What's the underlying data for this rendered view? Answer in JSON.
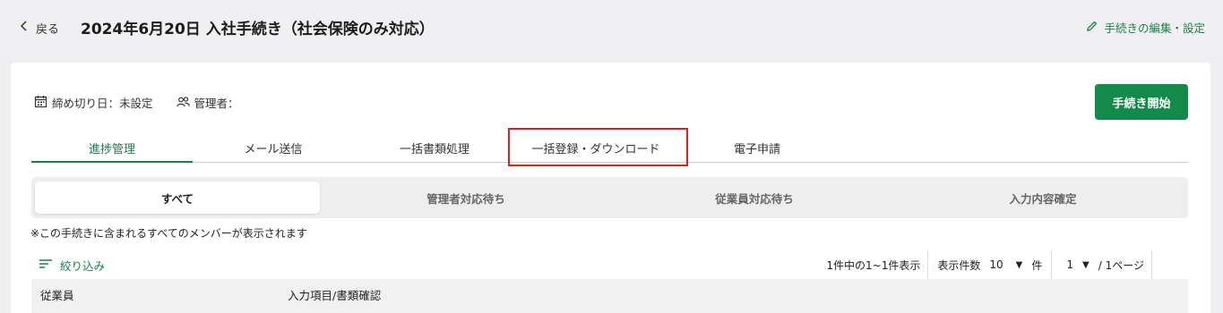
{
  "header": {
    "back_label": "戻る",
    "title": "2024年6月20日 入社手続き（社会保険のみ対応）",
    "edit_label": "手続きの編集・設定"
  },
  "meta": {
    "deadline": "締め切り日：未設定",
    "manager": "管理者："
  },
  "start_button": "手続き開始",
  "tabs": [
    {
      "label": "進捗管理",
      "active": true
    },
    {
      "label": "メール送信",
      "active": false
    },
    {
      "label": "一括書類処理",
      "active": false
    },
    {
      "label": "一括登録・ダウンロード",
      "active": false,
      "highlighted": true
    },
    {
      "label": "電子申請",
      "active": false
    }
  ],
  "subtabs": [
    {
      "label": "すべて",
      "active": true
    },
    {
      "label": "管理者対応待ち",
      "active": false
    },
    {
      "label": "従業員対応待ち",
      "active": false
    },
    {
      "label": "入力内容確定",
      "active": false
    }
  ],
  "note": "※この手続きに含まれるすべてのメンバーが表示されます",
  "filter_label": "絞り込み",
  "pagination": {
    "summary": "1件中の1~1件表示",
    "per_page_label": "表示件数",
    "per_page_value": "10",
    "per_page_unit": "件",
    "page_value": "1",
    "page_suffix": "/ 1ページ"
  },
  "table": {
    "columns": [
      "従業員",
      "入力項目/書類確認"
    ]
  },
  "colors": {
    "accent_green": "#138a4a",
    "highlight_red": "#e02020"
  }
}
